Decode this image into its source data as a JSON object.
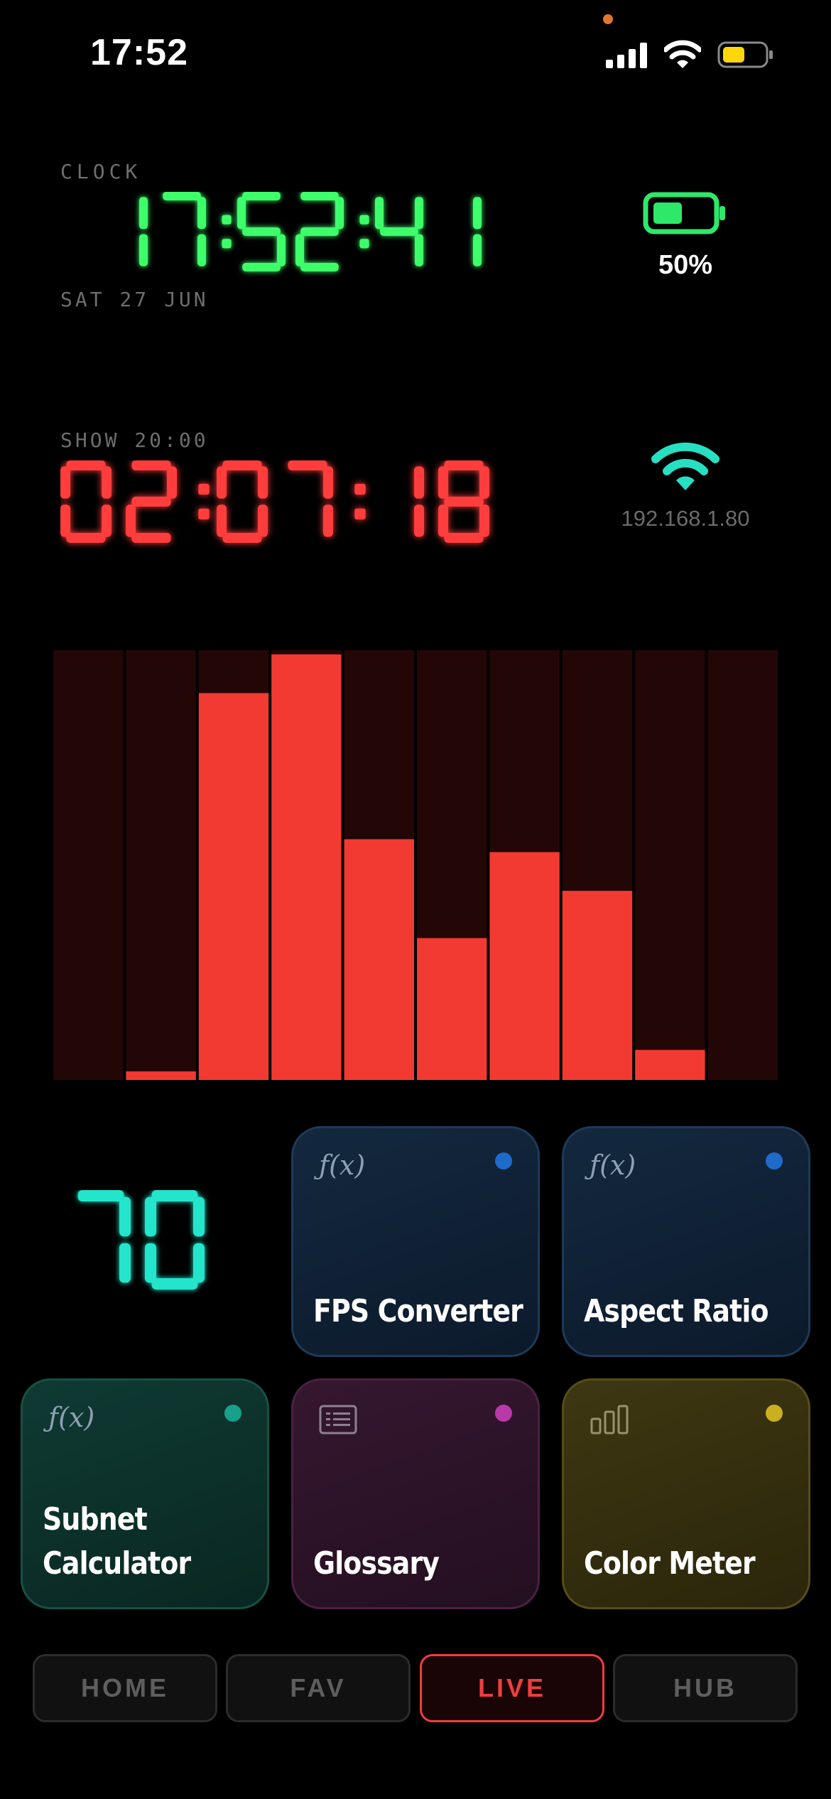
{
  "status_bar": {
    "time": "17:52"
  },
  "clock": {
    "label": "CLOCK",
    "time": "17:52:41",
    "date": "SAT 27 JUN",
    "color": "#3dff6a"
  },
  "show": {
    "label": "SHOW 20:00",
    "countdown": "02:07:18",
    "color": "#ff3c3c"
  },
  "battery": {
    "percent": "50%",
    "level": 0.5,
    "color": "#2ee86a"
  },
  "network": {
    "ip": "192.168.1.80",
    "color": "#27e0c4"
  },
  "meter": {
    "levels": [
      0.0,
      0.02,
      0.9,
      0.99,
      0.56,
      0.33,
      0.53,
      0.44,
      0.07,
      0.0
    ],
    "bar_color": "#f23a33",
    "track_color": "#230706"
  },
  "counter": {
    "value": "70",
    "color": "#22e5cc"
  },
  "tiles": [
    {
      "title": "FPS Converter",
      "icon": "function-icon",
      "icon_text": "ƒ(x)",
      "dot_color": "#1f6bc9"
    },
    {
      "title": "Aspect Ratio",
      "icon": "function-icon",
      "icon_text": "ƒ(x)",
      "dot_color": "#1f6bc9"
    },
    {
      "title": "Subnet\nCalculator",
      "title_line1": "Subnet",
      "title_line2": "Calculator",
      "icon": "function-icon",
      "icon_text": "ƒ(x)",
      "dot_color": "#17a08a"
    },
    {
      "title": "Glossary",
      "icon": "list-icon",
      "dot_color": "#b73aa8"
    },
    {
      "title": "Color Meter",
      "icon": "bar-chart-icon",
      "dot_color": "#c9b020"
    }
  ],
  "nav": {
    "home": "HOME",
    "fav": "FAV",
    "live": "LIVE",
    "hub": "HUB",
    "active": "LIVE"
  }
}
